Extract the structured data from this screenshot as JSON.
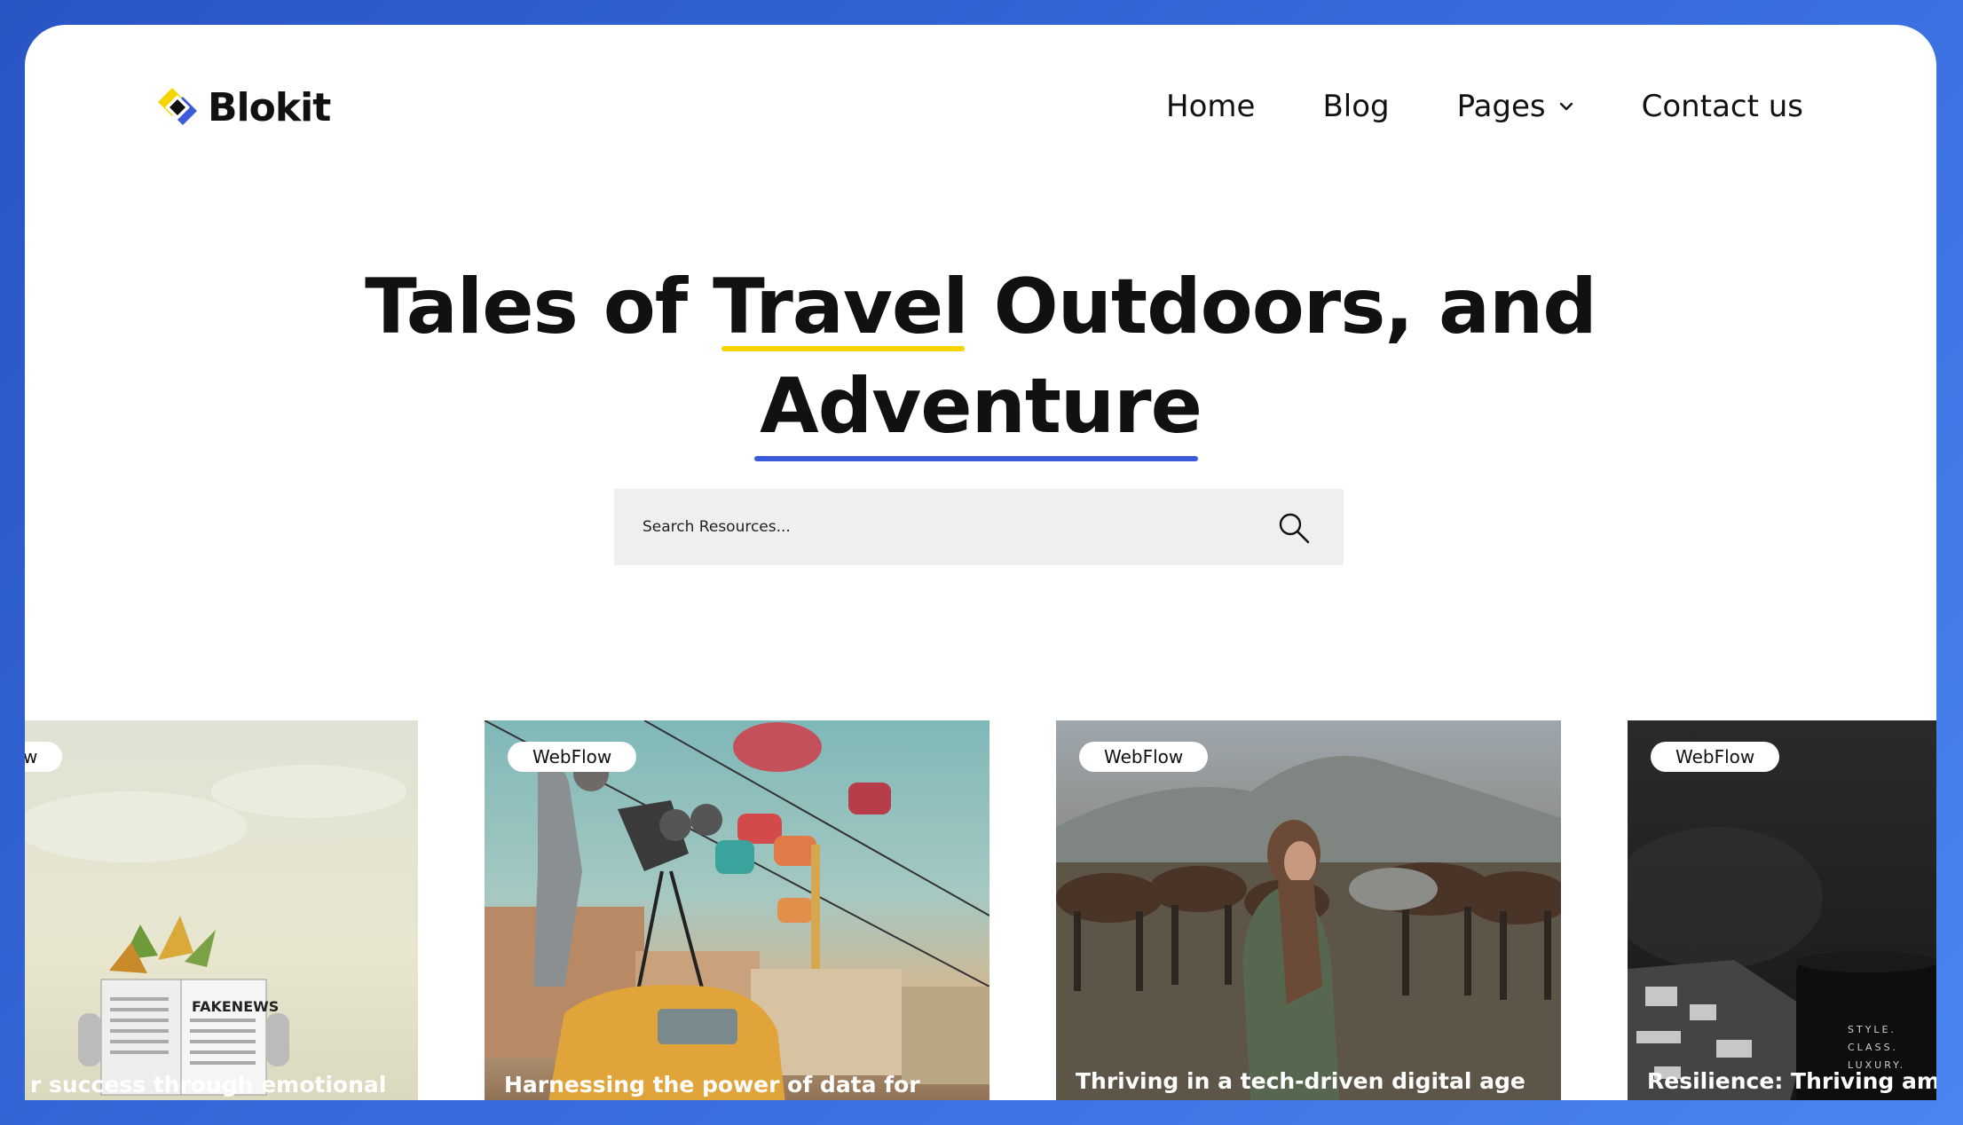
{
  "brand": {
    "name": "Blokit",
    "colors": {
      "yellow": "#f5d400",
      "blue": "#3b5bdb",
      "dark": "#111111"
    }
  },
  "nav": [
    {
      "label": "Home",
      "dropdown": false
    },
    {
      "label": "Blog",
      "dropdown": false
    },
    {
      "label": "Pages",
      "dropdown": true
    },
    {
      "label": "Contact us",
      "dropdown": false
    }
  ],
  "hero": {
    "line1_before": "Tales of ",
    "line1_highlight": "Travel",
    "line1_after": " Outdoors, and",
    "line2_highlight": "Adventure"
  },
  "search": {
    "placeholder": "Search Resources...",
    "icon": "search-icon"
  },
  "cards": [
    {
      "tag": "w",
      "title": "r success through emotional"
    },
    {
      "tag": "WebFlow",
      "title": "Harnessing the power of data for"
    },
    {
      "tag": "WebFlow",
      "title": "Thriving in a tech-driven digital age"
    },
    {
      "tag": "WebFlow",
      "title": "Resilience: Thriving amid"
    }
  ],
  "card_art": {
    "newspaper_text": "FAKENEWS",
    "mug_text": [
      "STYLE.",
      "CLASS.",
      "LUXURY."
    ]
  }
}
